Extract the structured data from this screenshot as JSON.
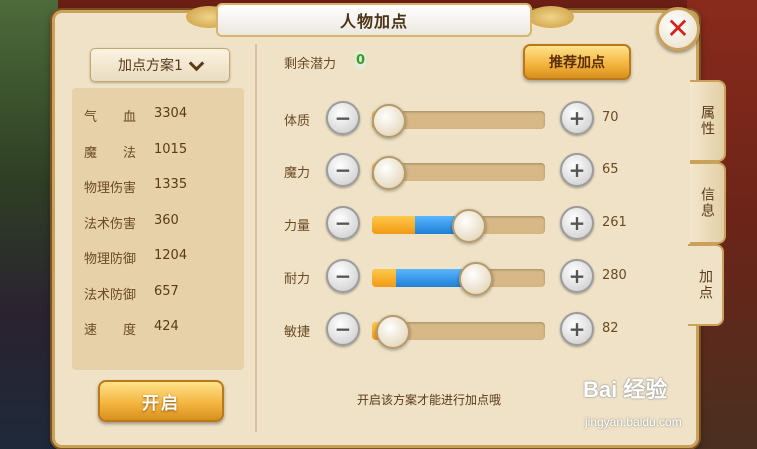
{
  "window": {
    "title": "人物加点",
    "close_icon": "close-icon"
  },
  "left_panel": {
    "plan_select": {
      "value": "加点方案1"
    },
    "stats": [
      {
        "name": "气　　血",
        "value": "3304"
      },
      {
        "name": "魔　　法",
        "value": "1015"
      },
      {
        "name": "物理伤害",
        "value": "1335"
      },
      {
        "name": "法术伤害",
        "value": "360"
      },
      {
        "name": "物理防御",
        "value": "1204"
      },
      {
        "name": "法术防御",
        "value": "657"
      },
      {
        "name": "速　　度",
        "value": "424"
      }
    ],
    "open_button": "开启"
  },
  "right_panel": {
    "remaining_label": "剩余潜力",
    "remaining_value": "0",
    "recommend_button": "推荐加点",
    "attributes": [
      {
        "label": "体质",
        "value": "70",
        "base_fraction": 0.05,
        "added_fraction": 0.0
      },
      {
        "label": "魔力",
        "value": "65",
        "base_fraction": 0.05,
        "added_fraction": 0.0
      },
      {
        "label": "力量",
        "value": "261",
        "base_fraction": 0.25,
        "added_fraction": 0.29
      },
      {
        "label": "耐力",
        "value": "280",
        "base_fraction": 0.14,
        "added_fraction": 0.44
      },
      {
        "label": "敏捷",
        "value": "82",
        "base_fraction": 0.1,
        "added_fraction": 0.0
      }
    ],
    "hint": "开启该方案才能进行加点哦"
  },
  "side_tabs": [
    {
      "label": "属性",
      "active": false
    },
    {
      "label": "信息",
      "active": false
    },
    {
      "label": "加点",
      "active": true
    }
  ],
  "watermark": {
    "main": "Bai 经验",
    "sub": "jingyan.baidu.com"
  },
  "colors": {
    "accent_gold": "#f2b23a",
    "bar_orange": "#f19a16",
    "bar_blue": "#1f7fd6",
    "close_red": "#d5211c",
    "remaining_green": "#3d9a2a"
  }
}
